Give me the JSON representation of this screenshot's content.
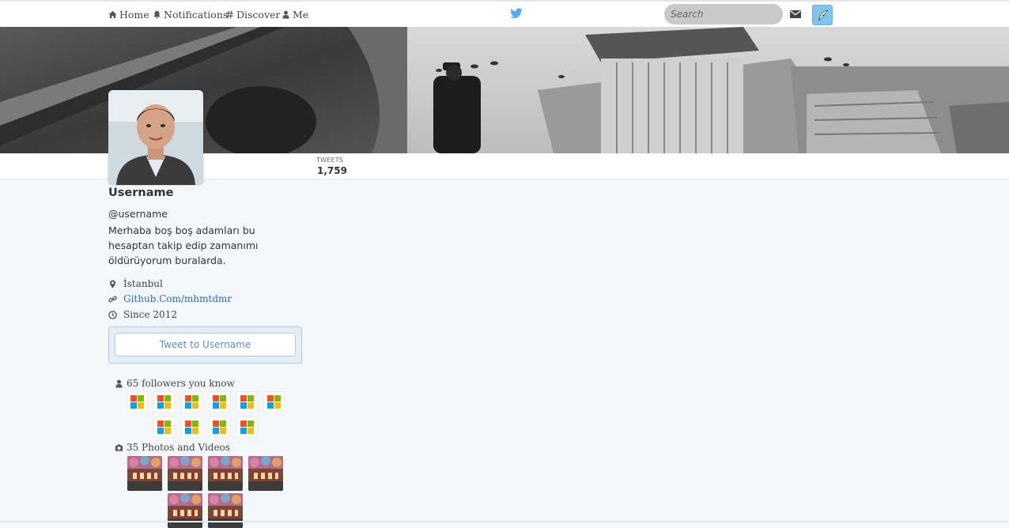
{
  "nav": {
    "home": "Home",
    "notifications": "Notifications",
    "discover": "Discover",
    "me": "Me",
    "search_placeholder": "Search"
  },
  "profile": {
    "name": "Username",
    "handle": "@username",
    "bio": "Merhaba boş boş adamları bu hesaptan takip edip zamanımı öldürüyorum buralarda.",
    "location": "İstanbul",
    "website": "Github.Com/mhmtdmr",
    "joined": "Since 2012"
  },
  "stats": {
    "tweets_label": "TWEETS",
    "tweets_value": "1,759"
  },
  "tweet_to_button": "Tweet to Username",
  "followers": {
    "heading": "65 followers you know",
    "count": 10
  },
  "photos": {
    "heading": "35 Photos and Videos",
    "count": 6
  },
  "colors": {
    "accent": "#55acee",
    "link": "#2a6db7",
    "page_bg": "#f4f7f9"
  },
  "icons": [
    "home-icon",
    "bell-icon",
    "hashtag-icon",
    "user-icon",
    "twitter-bird-icon",
    "envelope-icon",
    "quill-icon",
    "map-marker-icon",
    "link-icon",
    "clock-icon",
    "camera-icon"
  ]
}
